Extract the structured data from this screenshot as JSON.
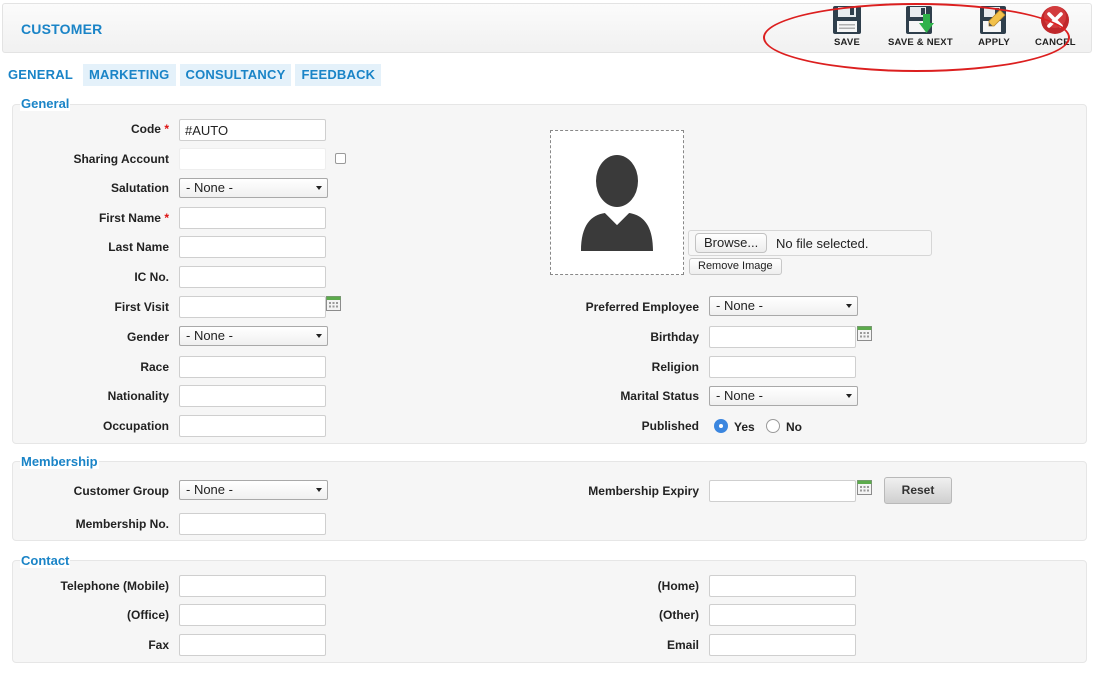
{
  "page": {
    "title": "CUSTOMER"
  },
  "toolbar": {
    "save": "SAVE",
    "save_next": "SAVE & NEXT",
    "apply": "APPLY",
    "cancel": "CANCEL"
  },
  "tabs": [
    "GENERAL",
    "MARKETING",
    "CONSULTANCY",
    "FEEDBACK"
  ],
  "active_tab": "GENERAL",
  "general": {
    "title": "General",
    "code": {
      "label": "Code",
      "value": "#AUTO",
      "required_mark": "*"
    },
    "sharing_account": {
      "label": "Sharing Account",
      "value": ""
    },
    "salutation": {
      "label": "Salutation",
      "value": "- None -"
    },
    "first_name": {
      "label": "First Name",
      "value": "",
      "required_mark": "*"
    },
    "last_name": {
      "label": "Last Name",
      "value": ""
    },
    "ic_no": {
      "label": "IC No.",
      "value": ""
    },
    "first_visit": {
      "label": "First Visit",
      "value": ""
    },
    "gender": {
      "label": "Gender",
      "value": "- None -"
    },
    "race": {
      "label": "Race",
      "value": ""
    },
    "nationality": {
      "label": "Nationality",
      "value": ""
    },
    "occupation": {
      "label": "Occupation",
      "value": ""
    },
    "photo": {
      "browse_label": "Browse...",
      "file_status": "No file selected.",
      "remove_label": "Remove Image"
    },
    "preferred_employee": {
      "label": "Preferred Employee",
      "value": "- None -"
    },
    "birthday": {
      "label": "Birthday",
      "value": ""
    },
    "religion": {
      "label": "Religion",
      "value": ""
    },
    "marital_status": {
      "label": "Marital Status",
      "value": "- None -"
    },
    "published": {
      "label": "Published",
      "yes": "Yes",
      "no": "No",
      "selected": "Yes"
    }
  },
  "membership": {
    "title": "Membership",
    "customer_group": {
      "label": "Customer Group",
      "value": "- None -"
    },
    "membership_no": {
      "label": "Membership No.",
      "value": ""
    },
    "membership_expiry": {
      "label": "Membership Expiry",
      "value": ""
    },
    "reset_label": "Reset"
  },
  "contact": {
    "title": "Contact",
    "telephone_mobile": {
      "label": "Telephone (Mobile)",
      "value": ""
    },
    "office": {
      "label": "(Office)",
      "value": ""
    },
    "fax": {
      "label": "Fax",
      "value": ""
    },
    "home": {
      "label": "(Home)",
      "value": ""
    },
    "other": {
      "label": "(Other)",
      "value": ""
    },
    "email": {
      "label": "Email",
      "value": ""
    }
  },
  "colors": {
    "accent": "#1a84c7",
    "highlight": "#dc1f1f",
    "required": "#dd1111"
  }
}
